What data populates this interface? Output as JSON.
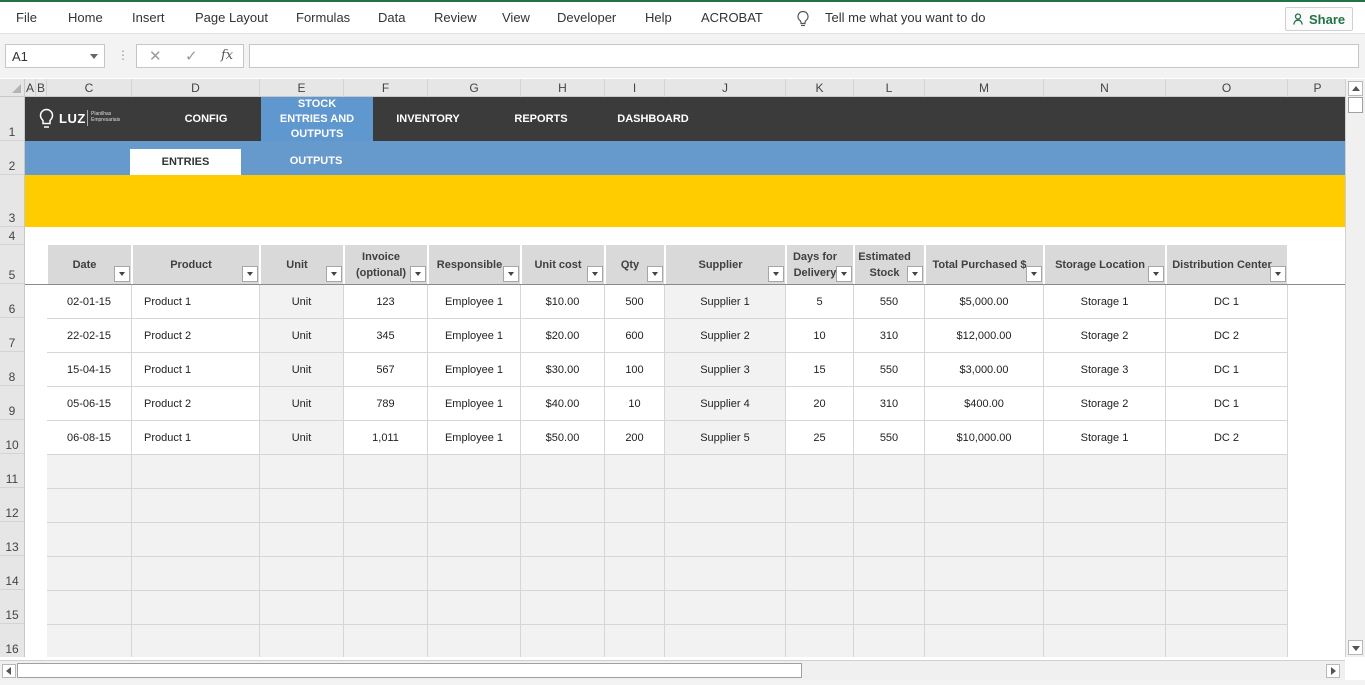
{
  "ribbon": {
    "menu": [
      "File",
      "Home",
      "Insert",
      "Page Layout",
      "Formulas",
      "Data",
      "Review",
      "View",
      "Developer",
      "Help",
      "ACROBAT"
    ],
    "tell_me": "Tell me what you want to do",
    "share": "Share"
  },
  "formula_bar": {
    "name_box": "A1",
    "fx": "fx",
    "formula": ""
  },
  "grid": {
    "columns": [
      "A",
      "B",
      "C",
      "D",
      "E",
      "F",
      "G",
      "H",
      "I",
      "J",
      "K",
      "L",
      "M",
      "N",
      "O",
      "P"
    ],
    "rows": [
      "1",
      "2",
      "3",
      "4",
      "5",
      "6",
      "7",
      "8",
      "9",
      "10",
      "11",
      "12",
      "13",
      "14",
      "15",
      "16"
    ]
  },
  "logo": {
    "name": "LUZ",
    "tagline_1": "Planilhas",
    "tagline_2": "Empresariais"
  },
  "nav": {
    "items": [
      "CONFIG",
      "STOCK ENTRIES AND OUTPUTS",
      "INVENTORY",
      "REPORTS",
      "DASHBOARD"
    ],
    "active_index": 1
  },
  "subtabs": {
    "items": [
      "ENTRIES",
      "OUTPUTS"
    ],
    "active_index": 0
  },
  "table": {
    "headers": [
      "Date",
      "Product",
      "Unit",
      "Invoice (optional)",
      "Responsible",
      "Unit cost",
      "Qty",
      "Supplier",
      "Days for Delivery",
      "Estimated Stock",
      "Total Purchased $",
      "Storage Location",
      "Distribution Center"
    ],
    "rows": [
      [
        "02-01-15",
        "Product 1",
        "Unit",
        "123",
        "Employee 1",
        "$10.00",
        "500",
        "Supplier 1",
        "5",
        "550",
        "$5,000.00",
        "Storage 1",
        "DC 1"
      ],
      [
        "22-02-15",
        "Product 2",
        "Unit",
        "345",
        "Employee 1",
        "$20.00",
        "600",
        "Supplier 2",
        "10",
        "310",
        "$12,000.00",
        "Storage 2",
        "DC 2"
      ],
      [
        "15-04-15",
        "Product 1",
        "Unit",
        "567",
        "Employee 1",
        "$30.00",
        "100",
        "Supplier 3",
        "15",
        "550",
        "$3,000.00",
        "Storage 3",
        "DC 1"
      ],
      [
        "05-06-15",
        "Product 2",
        "Unit",
        "789",
        "Employee 1",
        "$40.00",
        "10",
        "Supplier 4",
        "20",
        "310",
        "$400.00",
        "Storage 2",
        "DC 1"
      ],
      [
        "06-08-15",
        "Product 1",
        "Unit",
        "1,011",
        "Employee 1",
        "$50.00",
        "200",
        "Supplier 5",
        "25",
        "550",
        "$10,000.00",
        "Storage 1",
        "DC 2"
      ]
    ],
    "empty_rows": 6
  },
  "colors": {
    "excel_green": "#217346",
    "nav_dark": "#3b3b3b",
    "nav_active": "#5f97cf",
    "subtab_band": "#6699cc",
    "banner_yellow": "#ffcc00",
    "header_gray": "#d9d9d9",
    "shade_gray": "#f2f2f2"
  },
  "icons": {
    "tell_me": "lightbulb-icon",
    "share": "share-person-icon",
    "cancel": "close-x-icon",
    "enter": "check-icon",
    "logo": "lightbulb-logo-icon"
  }
}
